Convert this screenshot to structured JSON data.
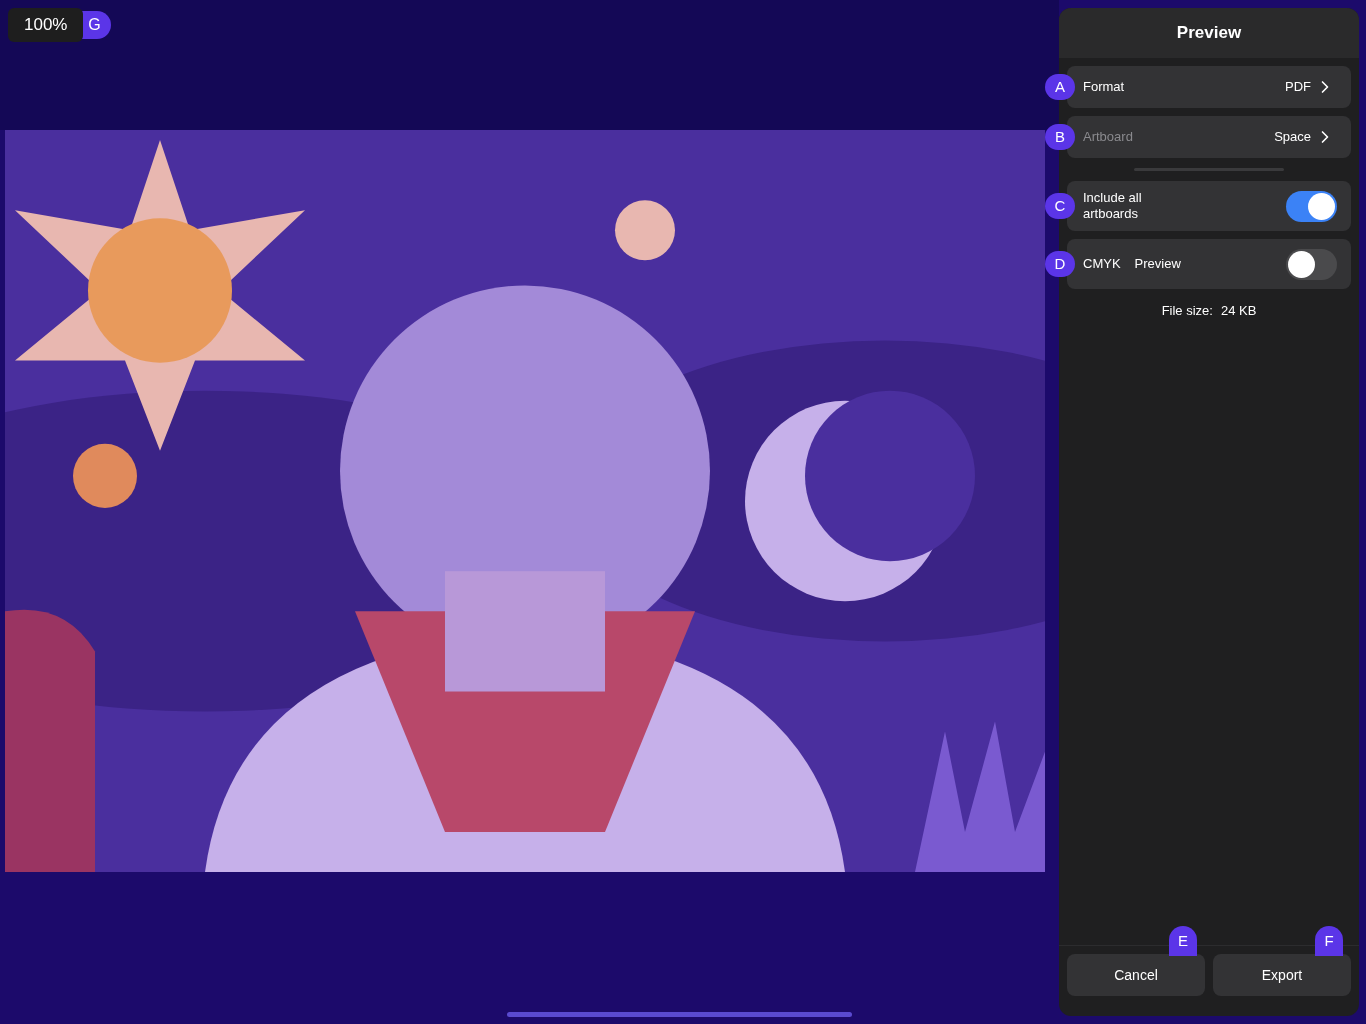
{
  "zoom": {
    "value": "100%",
    "badge": "G"
  },
  "panel": {
    "title": "Preview",
    "rows": [
      {
        "kind": "nav",
        "badge": "A",
        "label": "Format",
        "value": "PDF",
        "disabled": false
      },
      {
        "kind": "nav",
        "badge": "B",
        "label": "Artboard",
        "value": "Space",
        "disabled": true
      },
      {
        "kind": "toggle",
        "badge": "C",
        "label": "Include all artboards",
        "on": true
      },
      {
        "kind": "toggle",
        "badge": "D",
        "label": "CMYK",
        "suffix": "Preview",
        "on": false
      }
    ],
    "file_size": {
      "label": "File size:",
      "value": "24 KB"
    },
    "buttons": [
      {
        "badge": "E",
        "label": "Cancel"
      },
      {
        "badge": "F",
        "label": "Export"
      }
    ]
  }
}
